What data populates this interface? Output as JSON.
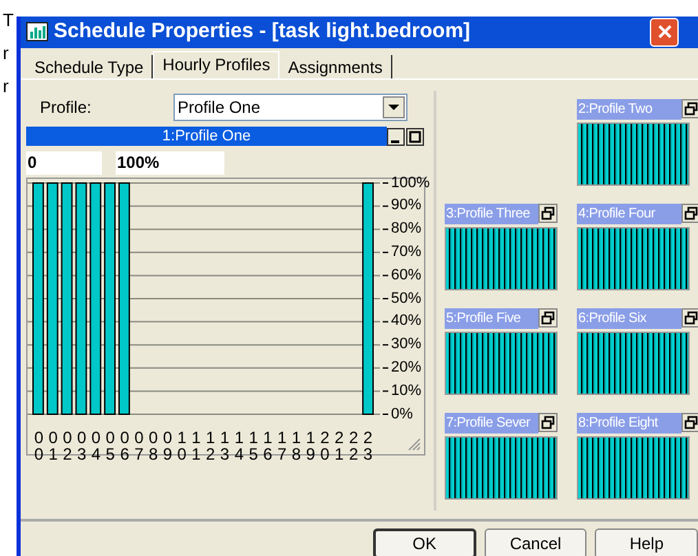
{
  "background_fragments": [
    "T",
    "r",
    "r"
  ],
  "window": {
    "title": "Schedule Properties - [task light.bedroom]"
  },
  "tabs": [
    {
      "label": "Schedule Type",
      "selected": false
    },
    {
      "label": "Hourly Profiles",
      "selected": true
    },
    {
      "label": "Assignments",
      "selected": false
    }
  ],
  "profile": {
    "label": "Profile:",
    "value": "Profile One"
  },
  "profile_window": {
    "title": "1:Profile One",
    "active": true,
    "fields": [
      "0",
      "100%"
    ],
    "chart_data": {
      "type": "bar",
      "categories": [
        "00",
        "01",
        "02",
        "03",
        "04",
        "05",
        "06",
        "07",
        "08",
        "09",
        "10",
        "11",
        "12",
        "13",
        "14",
        "15",
        "16",
        "17",
        "18",
        "19",
        "20",
        "21",
        "22",
        "23"
      ],
      "series": [
        {
          "color": "#00c8c8",
          "values": [
            100,
            100,
            100,
            100,
            100,
            100,
            100,
            0,
            0,
            0,
            0,
            0,
            0,
            0,
            0,
            0,
            0,
            0,
            0,
            0,
            0,
            0,
            0,
            100
          ]
        }
      ],
      "ylim": [
        0,
        100
      ],
      "grid": true,
      "yticks": [
        {
          "value": 100,
          "label": "100%"
        },
        {
          "value": 90,
          "label": "90%"
        },
        {
          "value": 80,
          "label": "80%"
        },
        {
          "value": 70,
          "label": "70%"
        },
        {
          "value": 60,
          "label": "60%"
        },
        {
          "value": 50,
          "label": "50%"
        },
        {
          "value": 40,
          "label": "40%"
        },
        {
          "value": 30,
          "label": "30%"
        },
        {
          "value": 20,
          "label": "20%"
        },
        {
          "value": 10,
          "label": "10%"
        },
        {
          "value": 0,
          "label": "0%"
        }
      ]
    }
  },
  "thumbnails": [
    {
      "title": "2:Profile Two",
      "active": false
    },
    {
      "title": "3:Profile Three",
      "active": false
    },
    {
      "title": "4:Profile Four",
      "active": false
    },
    {
      "title": "5:Profile Five",
      "active": false
    },
    {
      "title": "6:Profile Six",
      "active": false
    },
    {
      "title": "7:Profile Sever",
      "active": false
    },
    {
      "title": "8:Profile Eight",
      "active": false
    }
  ],
  "buttons": [
    {
      "label": "OK",
      "default": true
    },
    {
      "label": "Cancel",
      "default": false
    },
    {
      "label": "Help",
      "default": false
    }
  ]
}
